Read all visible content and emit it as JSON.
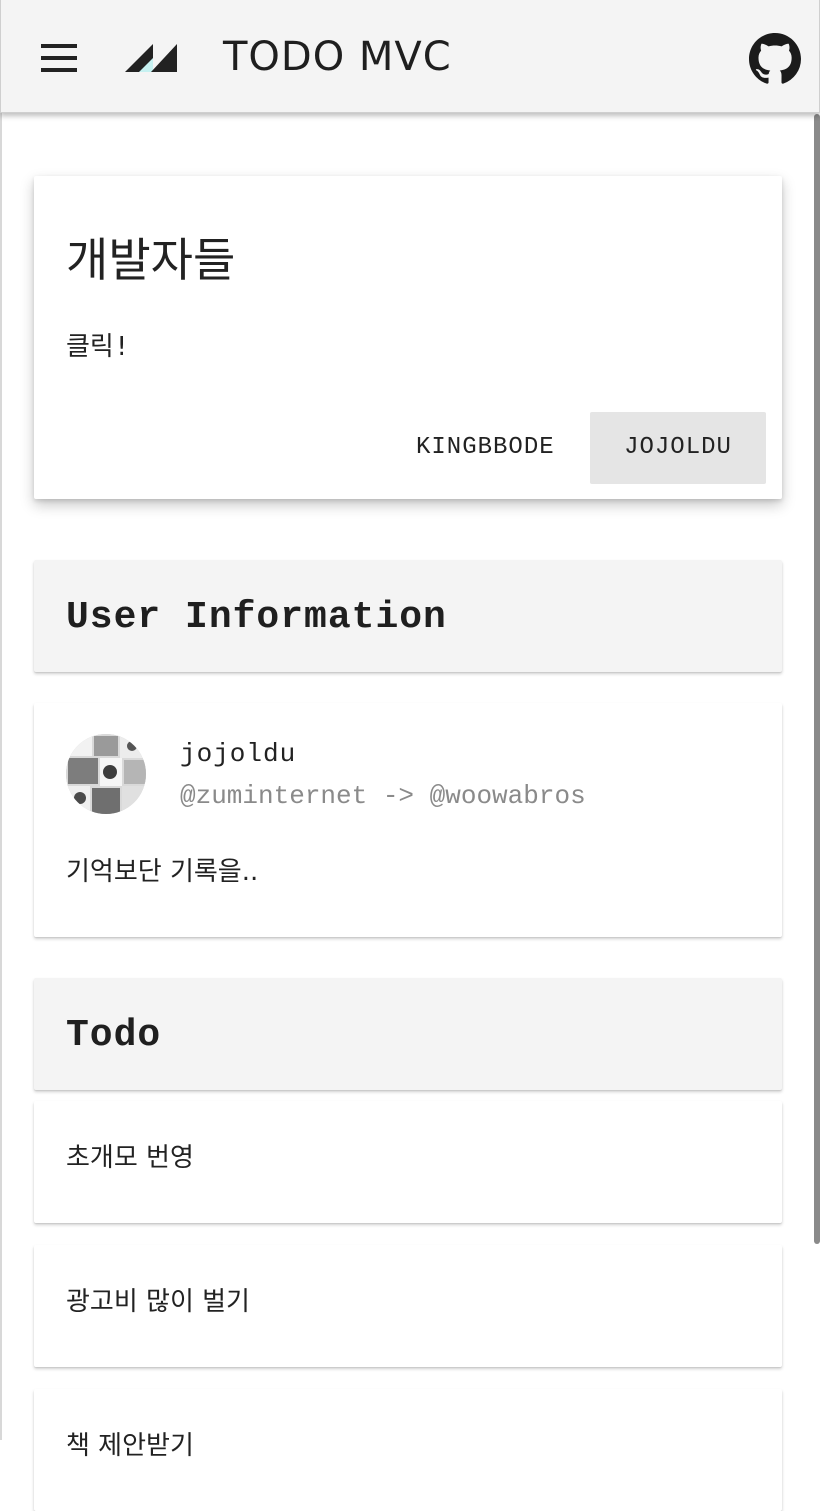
{
  "header": {
    "title": "TODO MVC",
    "menu_icon": "hamburger-menu-icon",
    "logo_icon": "app-logo-icon",
    "github_icon": "github-icon"
  },
  "developers_card": {
    "title": "개발자들",
    "subtitle": "클릭!",
    "buttons": [
      "KINGBBODE",
      "JOJOLDU"
    ],
    "selected_button": "JOJOLDU"
  },
  "user_section": {
    "header": "User Information",
    "username": "jojoldu",
    "company": "@zuminternet -> @woowabros",
    "bio": "기억보단 기록을..",
    "avatar_icon": "avatar-image"
  },
  "todo_section": {
    "header": "Todo",
    "items": [
      "초개모 번영",
      "광고비 많이 벌기",
      "책 제안받기"
    ]
  },
  "colors": {
    "header_bg": "#f4f4f4",
    "selected_button_bg": "#e5e5e5",
    "muted_text": "#8a8a8a",
    "logo_accent": "#c6f1f1"
  }
}
